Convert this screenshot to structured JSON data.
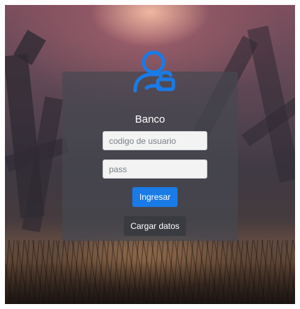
{
  "app": {
    "title": "Banco",
    "accent_color": "#1a7be6",
    "logo_icon": "user-lock-icon"
  },
  "form": {
    "username": {
      "placeholder": "codigo de usuario",
      "value": ""
    },
    "password": {
      "placeholder": "pass",
      "value": ""
    },
    "submit_label": "Ingresar",
    "load_data_label": "Cargar datos"
  }
}
